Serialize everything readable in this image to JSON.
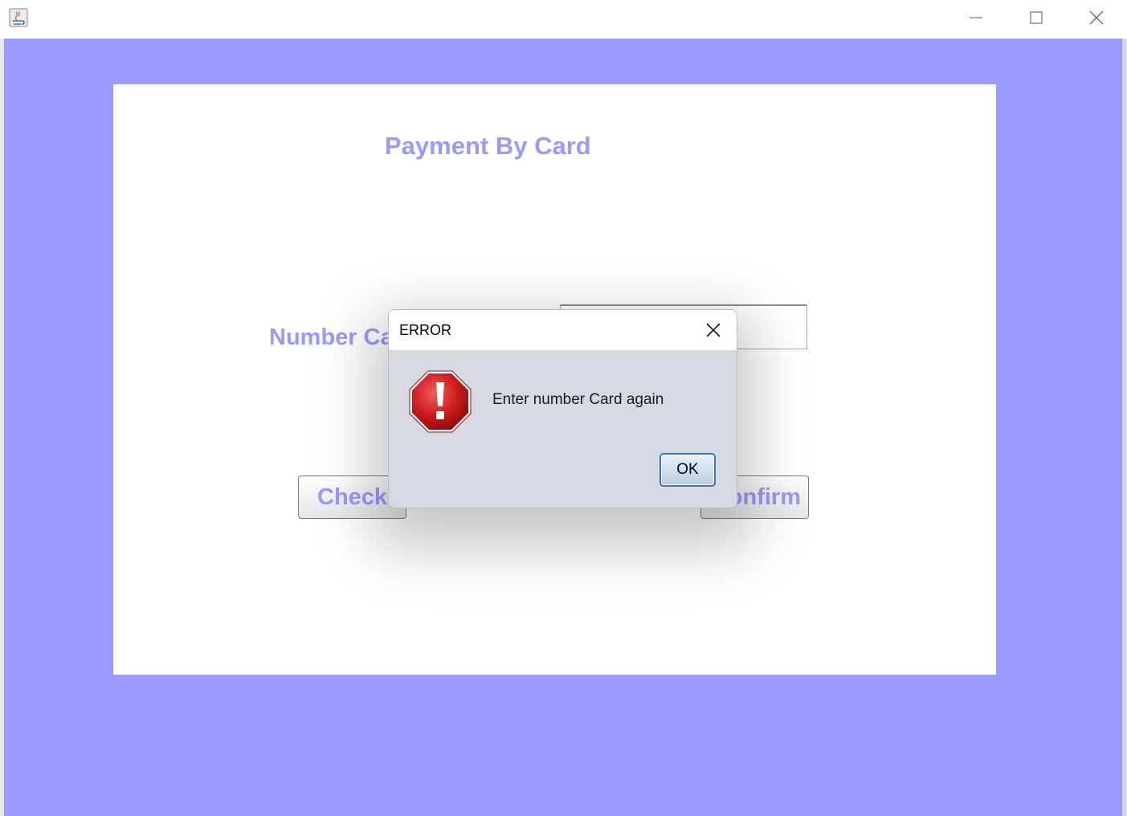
{
  "window": {
    "app_icon": "java-icon",
    "controls": [
      "minimize-icon",
      "maximize-icon",
      "close-icon"
    ]
  },
  "form": {
    "title": "Payment By Card",
    "number_label": "Number Card",
    "number_value": "",
    "check_button": "Check",
    "confirm_button": "Confirm"
  },
  "dialog": {
    "title": "ERROR",
    "message": "Enter number Card again",
    "ok_button": "OK",
    "icon": "error-stop-icon"
  },
  "colors": {
    "background": "#9999ff",
    "panel": "#ffffff",
    "accent_text": "#9999ff",
    "dialog_bg": "#d6d9e0",
    "error_red": "#cc1a1a"
  }
}
